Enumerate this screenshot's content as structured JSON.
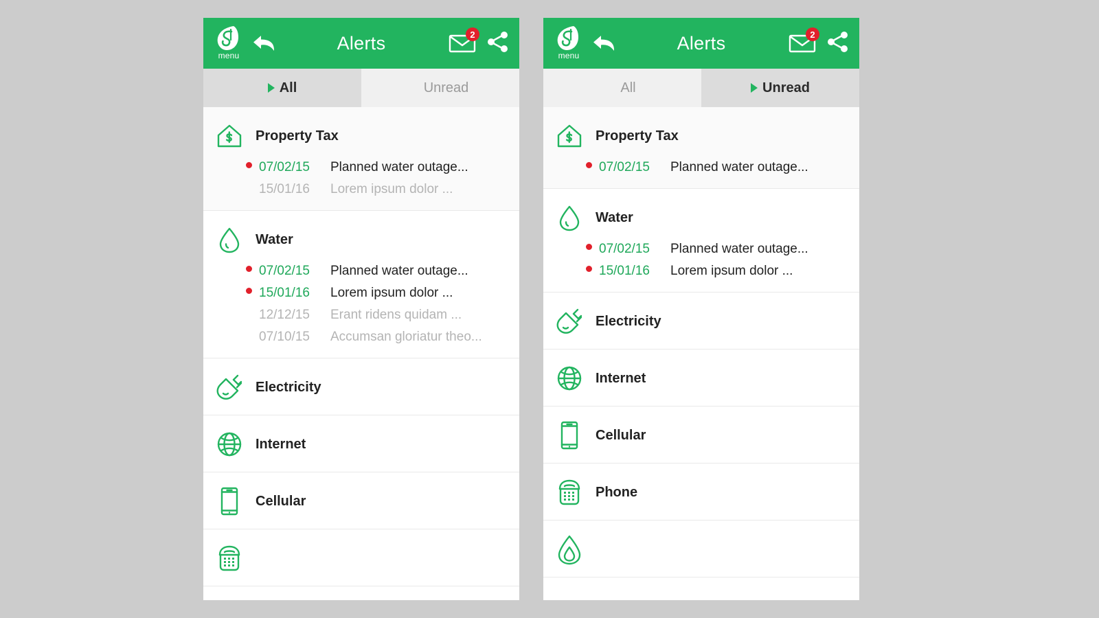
{
  "app": {
    "brand_green": "#22b45f",
    "accent_red": "#e1202b",
    "date_green": "#1fa85a",
    "muted_gray": "#b4b4b4",
    "page_background": "#cccccc"
  },
  "header": {
    "title": "Alerts",
    "menu_label": "menu",
    "logo_icon": "leaf-logo-icon",
    "back_icon": "back-arrow-icon",
    "mail_icon": "envelope-icon",
    "mail_badge_count": "2",
    "share_icon": "share-icon"
  },
  "panels": [
    {
      "id": "all-panel",
      "tabs": [
        {
          "label": "All",
          "active": true
        },
        {
          "label": "Unread",
          "active": false
        }
      ],
      "sections": [
        {
          "title": "Property Tax",
          "icon": "house-dollar-icon",
          "shaded": true,
          "alerts": [
            {
              "date": "07/02/15",
              "text": "Planned water outage...",
              "unread": true
            },
            {
              "date": "15/01/16",
              "text": "Lorem ipsum dolor ...",
              "unread": false
            }
          ]
        },
        {
          "title": "Water",
          "icon": "water-drop-icon",
          "shaded": false,
          "alerts": [
            {
              "date": "07/02/15",
              "text": "Planned water outage...",
              "unread": true
            },
            {
              "date": "15/01/16",
              "text": "Lorem ipsum dolor ...",
              "unread": true
            },
            {
              "date": "12/12/15",
              "text": "Erant ridens quidam ...",
              "unread": false
            },
            {
              "date": "07/10/15",
              "text": "Accumsan gloriatur theo...",
              "unread": false
            }
          ]
        },
        {
          "title": "Electricity",
          "icon": "power-plug-icon",
          "shaded": false,
          "alerts": []
        },
        {
          "title": "Internet",
          "icon": "globe-icon",
          "shaded": false,
          "alerts": []
        },
        {
          "title": "Cellular",
          "icon": "smartphone-icon",
          "shaded": false,
          "alerts": []
        },
        {
          "title": "",
          "icon": "desk-phone-icon",
          "shaded": false,
          "alerts": []
        }
      ]
    },
    {
      "id": "unread-panel",
      "tabs": [
        {
          "label": "All",
          "active": false
        },
        {
          "label": "Unread",
          "active": true
        }
      ],
      "sections": [
        {
          "title": "Property Tax",
          "icon": "house-dollar-icon",
          "shaded": true,
          "alerts": [
            {
              "date": "07/02/15",
              "text": "Planned water outage...",
              "unread": true
            }
          ]
        },
        {
          "title": "Water",
          "icon": "water-drop-icon",
          "shaded": false,
          "alerts": [
            {
              "date": "07/02/15",
              "text": "Planned water outage...",
              "unread": true
            },
            {
              "date": "15/01/16",
              "text": "Lorem ipsum dolor ...",
              "unread": true
            }
          ]
        },
        {
          "title": "Electricity",
          "icon": "power-plug-icon",
          "shaded": false,
          "alerts": []
        },
        {
          "title": "Internet",
          "icon": "globe-icon",
          "shaded": false,
          "alerts": []
        },
        {
          "title": "Cellular",
          "icon": "smartphone-icon",
          "shaded": false,
          "alerts": []
        },
        {
          "title": "Phone",
          "icon": "desk-phone-icon",
          "shaded": false,
          "alerts": []
        },
        {
          "title": "",
          "icon": "gas-flame-icon",
          "shaded": false,
          "alerts": []
        }
      ]
    }
  ]
}
